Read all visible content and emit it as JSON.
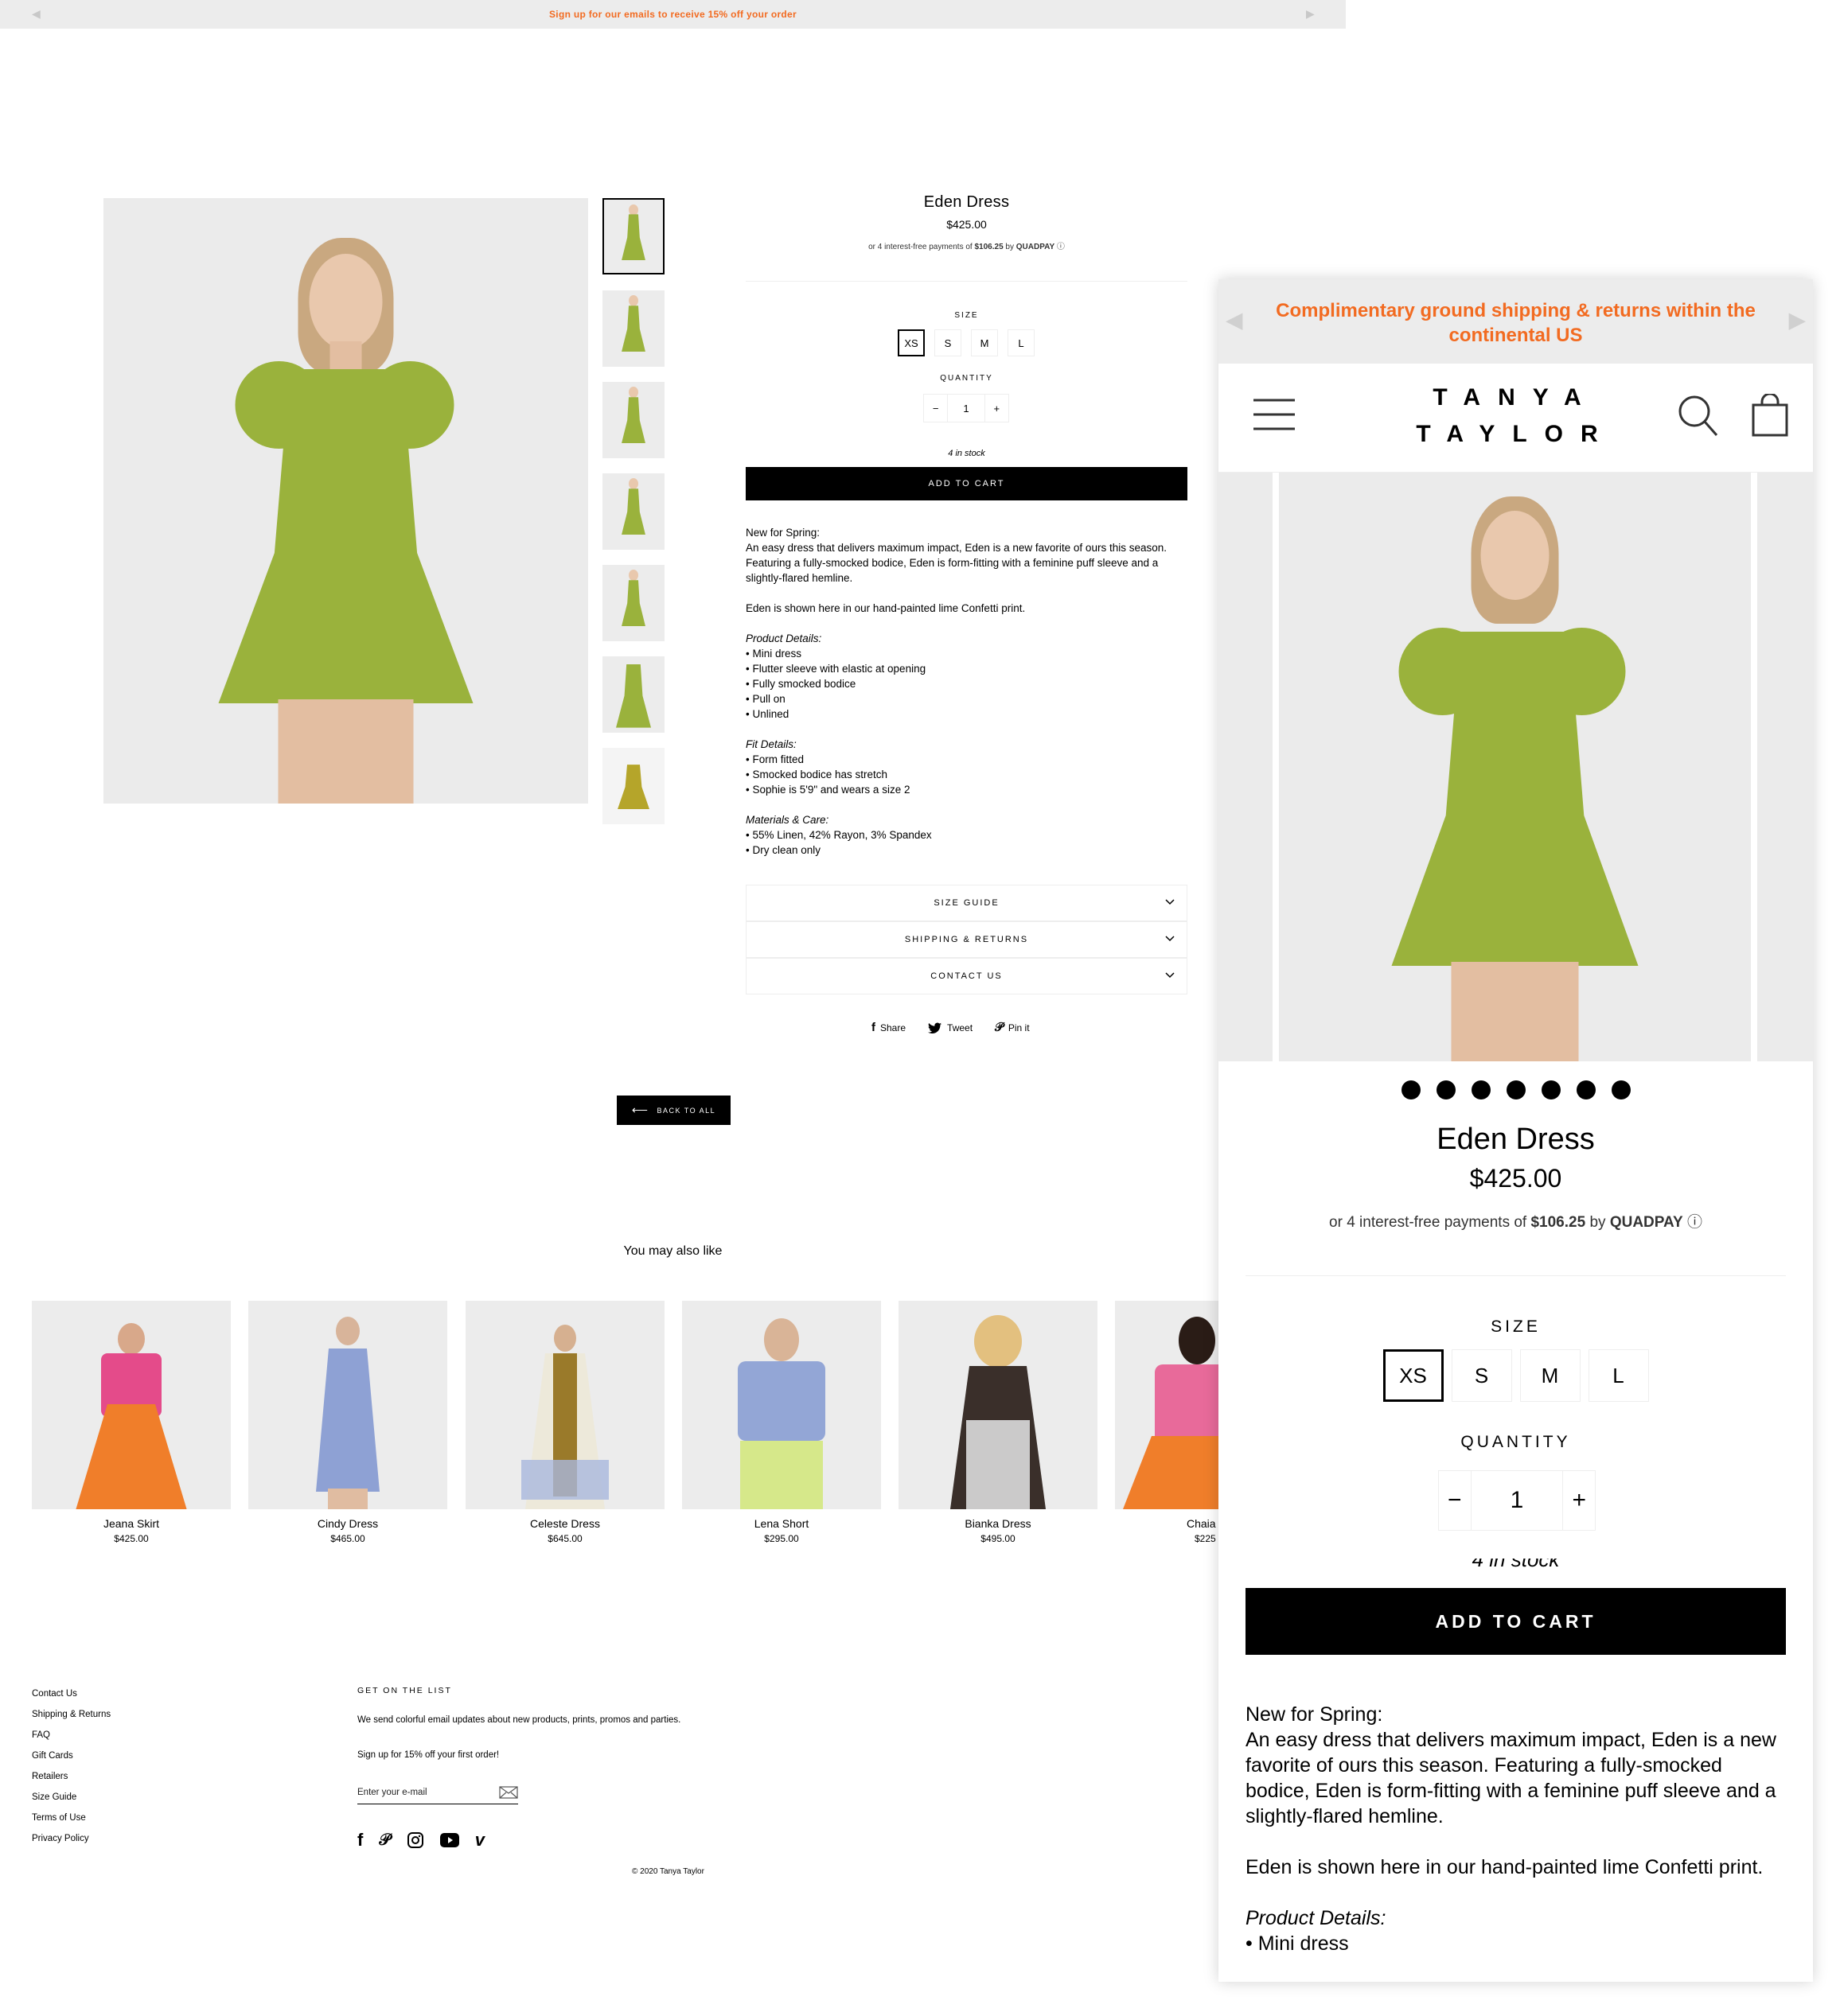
{
  "announcement": {
    "text": "Sign up for our emails to receive 15% off your order"
  },
  "product": {
    "title": "Eden Dress",
    "price": "$425.00",
    "installments_prefix": "or 4 interest-free payments of",
    "installment_amount": "$106.25",
    "installments_by": "by",
    "quadpay": "QUADPAY",
    "size_label": "SIZE",
    "sizes": [
      "XS",
      "S",
      "M",
      "L"
    ],
    "selected_size": "XS",
    "quantity_label": "QUANTITY",
    "quantity": "1",
    "minus": "−",
    "plus": "+",
    "stock": "4 in stock",
    "add_to_cart": "ADD TO CART",
    "desc_intro": "New for Spring:",
    "desc_body": "An easy dress that delivers maximum impact, Eden is a new favorite of ours this season. Featuring a fully-smocked bodice, Eden is form-fitting with a feminine puff sleeve and a slightly-flared hemline.",
    "desc_print": "Eden is shown here in our hand-painted lime Confetti print.",
    "product_details_heading": "Product Details:",
    "product_details": [
      "• Mini dress",
      "• Flutter sleeve with elastic at opening",
      "• Fully smocked bodice",
      "• Pull on",
      "• Unlined"
    ],
    "fit_details_heading": "Fit Details:",
    "fit_details": [
      "• Form fitted",
      "• Smocked bodice has stretch",
      "• Sophie is 5'9\" and wears a size 2"
    ],
    "materials_heading": "Materials & Care:",
    "materials": [
      "• 55% Linen, 42% Rayon, 3% Spandex",
      "• Dry clean only"
    ]
  },
  "accordions": [
    "SIZE GUIDE",
    "SHIPPING & RETURNS",
    "CONTACT US"
  ],
  "share": {
    "facebook": "Share",
    "twitter": "Tweet",
    "pinterest": "Pin it"
  },
  "back_button": "BACK TO ALL",
  "related": {
    "heading": "You may also like",
    "items": [
      {
        "name": "Jeana Skirt",
        "price": "$425.00"
      },
      {
        "name": "Cindy Dress",
        "price": "$465.00"
      },
      {
        "name": "Celeste Dress",
        "price": "$645.00"
      },
      {
        "name": "Lena Short",
        "price": "$295.00"
      },
      {
        "name": "Bianka Dress",
        "price": "$495.00"
      },
      {
        "name": "Chaia",
        "price": "$225"
      }
    ]
  },
  "footer": {
    "links": [
      "Contact Us",
      "Shipping & Returns",
      "FAQ",
      "Gift Cards",
      "Retailers",
      "Size Guide",
      "Terms of Use",
      "Privacy Policy"
    ],
    "newsletter_heading": "GET ON THE LIST",
    "newsletter_text": "We send colorful email updates about new products, prints, promos and parties.",
    "newsletter_offer": "Sign up for 15% off your first order!",
    "email_placeholder": "Enter your e-mail",
    "copyright": "© 2020 Tanya Taylor"
  },
  "mobile": {
    "announcement": "Complimentary ground shipping & returns within the continental US",
    "logo_line1": "TANYA",
    "logo_line2": "TAYLOR",
    "stock_partial": "4 in stock",
    "product_details_first": "• Mini dress"
  },
  "colors": {
    "accent_orange": "#f26b21",
    "dress_green": "#9ab23c",
    "black": "#000000",
    "bar_grey": "#ececec"
  }
}
